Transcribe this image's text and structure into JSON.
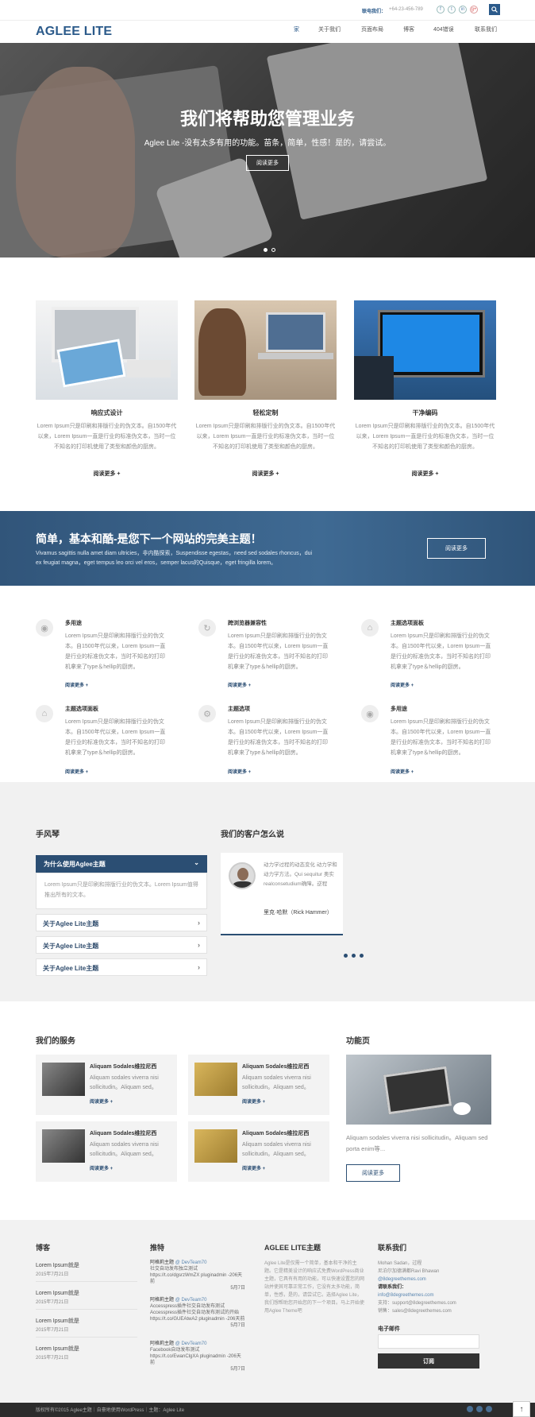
{
  "topbar": {
    "contact_label": "联电我们：",
    "phone": "+64-23-456-789",
    "social": [
      "f",
      "t",
      "in",
      "g+"
    ]
  },
  "header": {
    "logo": "AGLEE LITE",
    "nav": [
      "家",
      "关于我们",
      "页面布局",
      "博客",
      "404错误",
      "联系我们"
    ]
  },
  "hero": {
    "title": "我们将帮助您管理业务",
    "subtitle": "Aglee Lite -没有太多有用的功能。苗条，简单，性感！是的，请尝试。",
    "button": "阅读更多"
  },
  "features": [
    {
      "title": "响应式设计",
      "text": "Lorem Ipsum只是印刷和排版行业的伪文本。自1500年代以来，Lorem Ipsum一直是行业的标准伪文本，当时一位不知名的打印机使用了类型和颜色的厨房。",
      "more": "阅读更多 +"
    },
    {
      "title": "轻松定制",
      "text": "Lorem Ipsum只是印刷和排版行业的伪文本。自1500年代以来，Lorem Ipsum一直是行业的标准伪文本，当时一位不知名的打印机使用了类型和颜色的厨房。",
      "more": "阅读更多 +"
    },
    {
      "title": "干净编码",
      "text": "Lorem Ipsum只是印刷和排版行业的伪文本。自1500年代以来，Lorem Ipsum一直是行业的标准伪文本，当时一位不知名的打印机使用了类型和颜色的厨房。",
      "more": "阅读更多 +"
    }
  ],
  "banner": {
    "title": "简单，基本和酷-是您下一个网站的完美主题！",
    "text1": "Vivamus sagittis nulla amet diam ultricies，非内酷探索，Suspendisse egestas，need sed sodales rhoncus，dui",
    "text2": "ex feugiat magna，eget tempus leo orci vel eros，semper lacus的Quisque，eget fringilla lorem。",
    "button": "阅读更多"
  },
  "services": [
    {
      "title": "多用途",
      "text": "Lorem Ipsum只是印刷和排版行业的伪文本。自1500年代以来，Lorem Ipsum一直是行业的标准伪文本，当时不知名的打印机拿来了type＆hellip的厨房。",
      "more": "阅读更多 +"
    },
    {
      "title": "跨浏览器兼容性",
      "text": "Lorem Ipsum只是印刷和排版行业的伪文本。自1500年代以来，Lorem Ipsum一直是行业的标准伪文本，当时不知名的打印机拿来了type＆hellip的厨房。",
      "more": "阅读更多 +"
    },
    {
      "title": "主题选项面板",
      "text": "Lorem Ipsum只是印刷和排版行业的伪文本。自1500年代以来，Lorem Ipsum一直是行业的标准伪文本，当时不知名的打印机拿来了type＆hellip的厨房。",
      "more": "阅读更多 +"
    },
    {
      "title": "主题选项面板",
      "text": "Lorem Ipsum只是印刷和排版行业的伪文本。自1500年代以来，Lorem Ipsum一直是行业的标准伪文本，当时不知名的打印机拿来了type＆hellip的厨房。",
      "more": "阅读更多 +"
    },
    {
      "title": "主题选项",
      "text": "Lorem Ipsum只是印刷和排版行业的伪文本。自1500年代以来，Lorem Ipsum一直是行业的标准伪文本，当时不知名的打印机拿来了type＆hellip的厨房。",
      "more": "阅读更多 +"
    },
    {
      "title": "多用途",
      "text": "Lorem Ipsum只是印刷和排版行业的伪文本。自1500年代以来，Lorem Ipsum一直是行业的标准伪文本，当时不知名的打印机拿来了type＆hellip的厨房。",
      "more": "阅读更多 +"
    }
  ],
  "accordion": {
    "heading": "手风琴",
    "active": "为什么使用Aglee主题",
    "active_text": "Lorem Ipsum只是印刷和排版行业的伪文本。Lorem Ipsum值得推出所有的文本。",
    "items": [
      "关于Aglee Lite主题",
      "关于Aglee Lite主题",
      "关于Aglee Lite主题"
    ]
  },
  "testimonials": {
    "heading": "我们的客户怎么说",
    "quote": "动力学过程的动态变化 动力学和动力学方法。Qui sequitur 奥实realconsetudium确障。逆程",
    "author": "里克·哈默（Rick Hammer）"
  },
  "our_services": {
    "heading": "我们的服务",
    "items": [
      {
        "title": "Aliquam Sodales维拉尼西",
        "text": "Aliquam sodales viverra nisi sollicitudin。Aliquam sed。",
        "more": "阅读更多 +"
      },
      {
        "title": "Aliquam Sodales维拉尼西",
        "text": "Aliquam sodales viverra nisi sollicitudin。Aliquam sed。",
        "more": "阅读更多 +"
      },
      {
        "title": "Aliquam Sodales维拉尼西",
        "text": "Aliquam sodales viverra nisi sollicitudin。Aliquam sed。",
        "more": "阅读更多 +"
      },
      {
        "title": "Aliquam Sodales维拉尼西",
        "text": "Aliquam sodales viverra nisi sollicitudin。Aliquam sed。",
        "more": "阅读更多 +"
      }
    ]
  },
  "feature_page": {
    "heading": "功能页",
    "text": "Aliquam sodales viverra nisi sollicitudin。Aliquam sed porta enim等...",
    "button": "阅读更多"
  },
  "footer": {
    "blog": {
      "heading": "博客",
      "posts": [
        {
          "title": "Lorem Ipsum就是",
          "date": "2015年7月21日"
        },
        {
          "title": "Lorem Ipsum就是",
          "date": "2015年7月21日"
        },
        {
          "title": "Lorem Ipsum就是",
          "date": "2015年7月21日"
        },
        {
          "title": "Lorem Ipsum就是",
          "date": "2015年7月21日"
        }
      ]
    },
    "tweets": {
      "heading": "推特",
      "items": [
        {
          "user": "阿格莉主题",
          "handle": "@ DevTeam70",
          "body": "社交自动发布独立测试 https://t.co/dgsrzWmZX pluginadmin -206天前",
          "meta": "5月7日"
        },
        {
          "user": "阿格莉主题",
          "handle": "@ DevTeam70",
          "body": "Accesspress插件社交自动发布测试 Accesspress插件社交自动发布测试的开始 https://t.co/GUEAtwA2 pluginadmin -206天前",
          "meta": "5月7日"
        },
        {
          "user": "阿格莉主题",
          "handle": "@ DevTeam70",
          "body": "Facebook自动发布测试 https://t.co/EwanClgXA pluginadmin -206天前",
          "meta": "5月7日"
        }
      ]
    },
    "about": {
      "heading": "AGLEE LITE主题",
      "text": "Aglee Lite是仅需一个简单，基本和干净的主题。它是精美设计的响应式免费WordPress商业主题，它具有有用的功能，可以快速设置您的网站并使其可靠正常工作，它没有太多功能，简单，性感，是的，请尝试它。选择Aglee Lite，我们想帮助您开始您的下一个项目。马上开始使用Aglee Theme吧"
    },
    "contact": {
      "heading": "联系我们",
      "lines": [
        "Mohan Sadan，过程",
        "尼泊尔加德满都Ravi Bhawan",
        "@8degreethemes.com",
        "请联系我们：",
        "info@8degreethemes.com",
        "支持：support@8degreethemes.com",
        "销售：sales@8degreethemes.com"
      ],
      "email_label": "电子邮件",
      "subscribe": "订阅"
    }
  },
  "bottom": {
    "text": "版权所有©2015 Aglee主题｜自豪地使用WordPress｜主题：Aglee Lite"
  },
  "colors": {
    "brand": "#2b5a8a",
    "banner": "#3a6189",
    "dark": "#2c2c2c"
  }
}
